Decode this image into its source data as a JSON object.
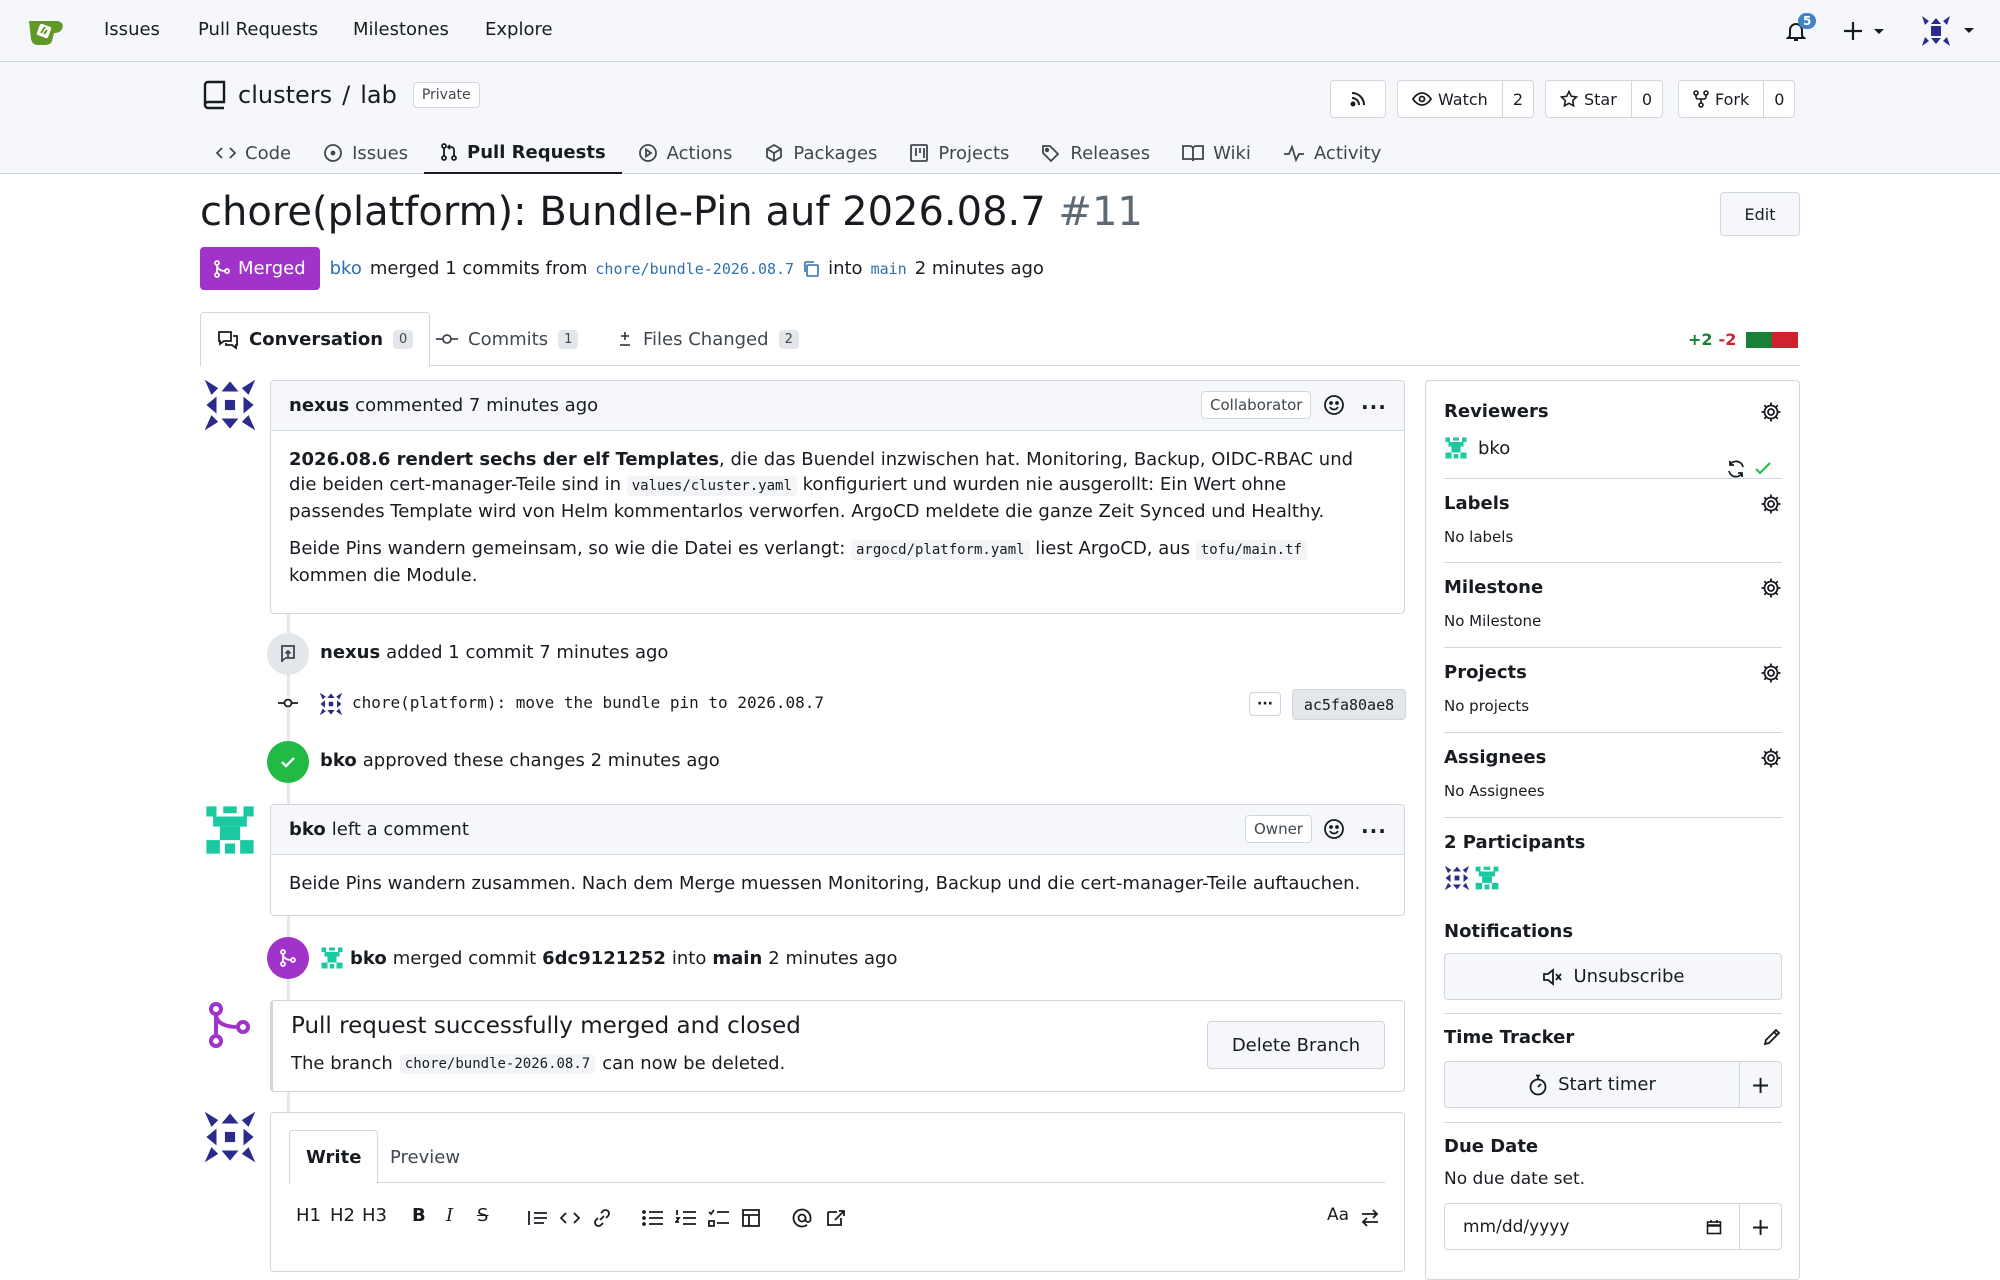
{
  "nav": {
    "items": [
      "Issues",
      "Pull Requests",
      "Milestones",
      "Explore"
    ],
    "notif_count": "5"
  },
  "repo": {
    "owner": "clusters",
    "sep": "/",
    "name": "lab",
    "visibility": "Private",
    "watch": {
      "label": "Watch",
      "count": "2"
    },
    "star": {
      "label": "Star",
      "count": "0"
    },
    "fork": {
      "label": "Fork",
      "count": "0"
    },
    "tabs": [
      "Code",
      "Issues",
      "Pull Requests",
      "Actions",
      "Packages",
      "Projects",
      "Releases",
      "Wiki",
      "Activity"
    ]
  },
  "pr": {
    "title": "chore(platform): Bundle-Pin auf 2026.08.7",
    "number": "#11",
    "edit": "Edit",
    "status": "Merged",
    "author": "bko",
    "merged_text": "merged 1 commits from",
    "branch": "chore/bundle-2026.08.7",
    "into": "into",
    "base": "main",
    "time": "2 minutes ago"
  },
  "prtabs": {
    "conversation": {
      "label": "Conversation",
      "count": "0"
    },
    "commits": {
      "label": "Commits",
      "count": "1"
    },
    "files": {
      "label": "Files Changed",
      "count": "2"
    },
    "add": "+2",
    "del": "-2"
  },
  "comment1": {
    "author": "nexus",
    "action": "commented 7 minutes ago",
    "role": "Collaborator",
    "p1_bold": "2026.08.6 rendert sechs der elf Templates",
    "p1_a": ", die das Buendel inzwischen hat. Monitoring, Backup, OIDC-RBAC und die beiden cert-manager-Teile sind in ",
    "p1_code": "values/cluster.yaml",
    "p1_b": " konfiguriert und wurden nie ausgerollt: Ein Wert ohne passendes Template wird von Helm kommentarlos verworfen. ArgoCD meldete die ganze Zeit Synced und Healthy.",
    "p2_a": "Beide Pins wandern gemeinsam, so wie die Datei es verlangt: ",
    "p2_code1": "argocd/platform.yaml",
    "p2_b": " liest ArgoCD, aus ",
    "p2_code2": "tofu/main.tf",
    "p2_c": " kommen die Module."
  },
  "event_commit": {
    "author": "nexus",
    "text": "added 1 commit 7 minutes ago",
    "message": "chore(platform): move the bundle pin to 2026.08.7",
    "sha": "ac5fa80ae8",
    "more": "···"
  },
  "event_approve": {
    "author": "bko",
    "text": "approved these changes 2 minutes ago"
  },
  "comment2": {
    "author": "bko",
    "action": "left a comment",
    "role": "Owner",
    "body": "Beide Pins wandern zusammen. Nach dem Merge muessen Monitoring, Backup und die cert-manager-Teile auftauchen."
  },
  "event_merge": {
    "author": "bko",
    "text1": "merged commit",
    "commit": "6dc9121252",
    "text2": "into",
    "base": "main",
    "time": "2 minutes ago"
  },
  "merged_box": {
    "title": "Pull request successfully merged and closed",
    "text_a": "The branch",
    "branch": "chore/bundle-2026.08.7",
    "text_b": "can now be deleted.",
    "delete": "Delete Branch"
  },
  "editor": {
    "write": "Write",
    "preview": "Preview",
    "toolbar": [
      "H1",
      "H2",
      "H3"
    ]
  },
  "sidebar": {
    "reviewers": "Reviewers",
    "reviewer": "bko",
    "labels": "Labels",
    "no_labels": "No labels",
    "milestone": "Milestone",
    "no_milestone": "No Milestone",
    "projects": "Projects",
    "no_projects": "No projects",
    "assignees": "Assignees",
    "no_assignees": "No Assignees",
    "participants": "2 Participants",
    "notifications": "Notifications",
    "unsubscribe": "Unsubscribe",
    "time_tracker": "Time Tracker",
    "start_timer": "Start timer",
    "due_date": "Due Date",
    "no_due": "No due date set.",
    "date_placeholder": "mm/dd/yyyy"
  },
  "colors": {
    "merged": "#a033c9",
    "approve": "#21ba45",
    "link": "#2f6fb0",
    "add": "#1a7f37",
    "del": "#cf222e"
  }
}
